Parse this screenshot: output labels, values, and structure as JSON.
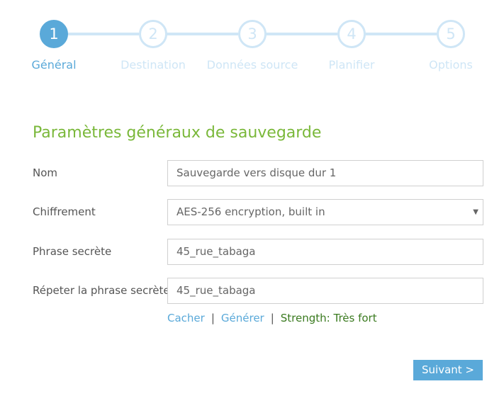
{
  "stepper": {
    "steps": [
      {
        "number": "1",
        "label": "Général",
        "active": true
      },
      {
        "number": "2",
        "label": "Destination",
        "active": false
      },
      {
        "number": "3",
        "label": "Données source",
        "active": false
      },
      {
        "number": "4",
        "label": "Planifier",
        "active": false
      },
      {
        "number": "5",
        "label": "Options",
        "active": false
      }
    ]
  },
  "form": {
    "title": "Paramètres généraux de sauvegarde",
    "name": {
      "label": "Nom",
      "value": "Sauvegarde vers disque dur 1"
    },
    "encryption": {
      "label": "Chiffrement",
      "value": "AES-256 encryption, built in"
    },
    "passphrase": {
      "label": "Phrase secrète",
      "value": "45_rue_tabaga"
    },
    "passphrase_repeat": {
      "label": "Répeter la phrase secrète",
      "value": "45_rue_tabaga"
    },
    "actions": {
      "hide": "Cacher",
      "separator": "|",
      "generate": "Générer",
      "strength": "Strength: Très fort"
    },
    "next": "Suivant >"
  },
  "colors": {
    "accent": "#5aa9d9",
    "inactive_step": "#cfe6f6",
    "title": "#7ab83a",
    "strength": "#3a7a1f"
  },
  "icons": {
    "dropdown": "chevron-down-icon"
  }
}
